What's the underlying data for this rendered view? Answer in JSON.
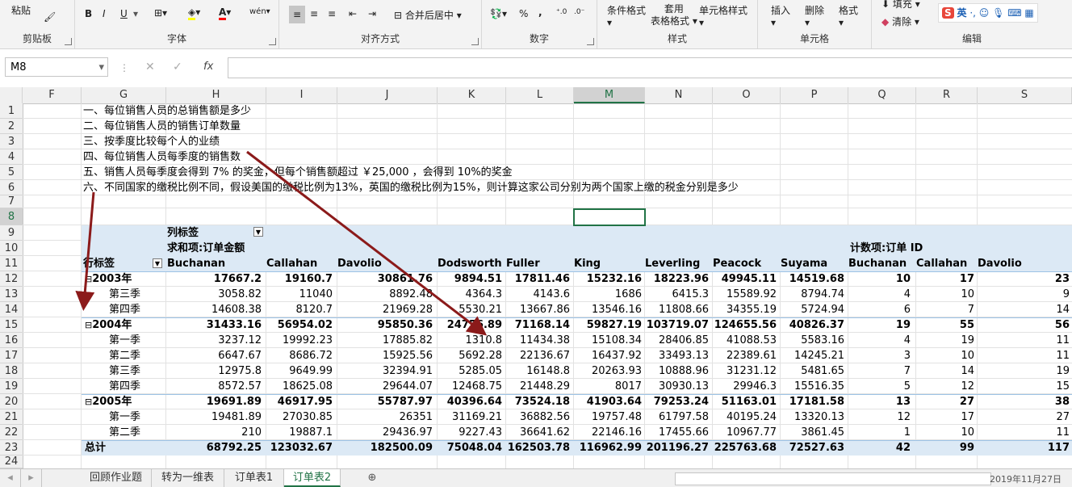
{
  "ribbon": {
    "clipboard": {
      "paste": "粘贴",
      "title": "剪贴板"
    },
    "font": {
      "bold": "B",
      "italic": "I",
      "underline": "U",
      "font_color": "A",
      "title": "字体"
    },
    "align": {
      "merge": "合并后居中",
      "title": "对齐方式"
    },
    "number": {
      "percent": "%",
      "comma": ",",
      "title": "数字"
    },
    "styles": {
      "conditional": "条件格式",
      "table_line1": "套用",
      "table_line2": "表格格式",
      "cell_styles": "单元格样式",
      "title": "样式"
    },
    "cells": {
      "insert": "插入",
      "delete": "删除",
      "format": "格式",
      "title": "单元格"
    },
    "edit": {
      "fill": "填充",
      "clear": "清除",
      "title": "编辑"
    },
    "ime": {
      "lang": "英"
    }
  },
  "formula": {
    "name_box": "M8",
    "fx": "fx"
  },
  "columns": [
    "F",
    "G",
    "H",
    "I",
    "J",
    "K",
    "L",
    "M",
    "N",
    "O",
    "P",
    "Q",
    "R",
    "S"
  ],
  "rows": [
    "1",
    "2",
    "3",
    "4",
    "5",
    "6",
    "7",
    "8",
    "9",
    "10",
    "11",
    "12",
    "13",
    "14",
    "15",
    "16",
    "17",
    "18",
    "19",
    "20",
    "21",
    "22",
    "23",
    "24"
  ],
  "questions": [
    "一、每位销售人员的总销售额是多少",
    "二、每位销售人员的销售订单数量",
    "三、按季度比较每个人的业绩",
    "四、每位销售人员每季度的销售数",
    "五、销售人员每季度会得到 7% 的奖金，但每个销售额超过 ￥25,000 ，会得到 10%的奖金",
    "六、不同国家的缴税比例不同，假设美国的缴税比例为13%，英国的缴税比例为15%，则计算这家公司分别为两个国家上缴的税金分别是多少"
  ],
  "pivot": {
    "col_label": "列标签",
    "sum_label": "求和项:订单金额",
    "count_label": "计数项:订单 ID",
    "row_label": "行标签",
    "headers": [
      "Buchanan",
      "Callahan",
      "Davolio",
      "Dodsworth",
      "Fuller",
      "King",
      "Leverling",
      "Peacock",
      "Suyama",
      "Buchanan",
      "Callahan",
      "Davolio"
    ],
    "rows": [
      {
        "label": "2003年",
        "level": 0,
        "collapse": "⊟",
        "values": [
          "17667.2",
          "19160.7",
          "30861.76",
          "9894.51",
          "17811.46",
          "15232.16",
          "18223.96",
          "49945.11",
          "14519.68",
          "10",
          "17",
          "23"
        ]
      },
      {
        "label": "第三季",
        "level": 1,
        "values": [
          "3058.82",
          "11040",
          "8892.48",
          "4364.3",
          "4143.6",
          "1686",
          "6415.3",
          "15589.92",
          "8794.74",
          "4",
          "10",
          "9"
        ]
      },
      {
        "label": "第四季",
        "level": 1,
        "values": [
          "14608.38",
          "8120.7",
          "21969.28",
          "5530.21",
          "13667.86",
          "13546.16",
          "11808.66",
          "34355.19",
          "5724.94",
          "6",
          "7",
          "14"
        ]
      },
      {
        "label": "2004年",
        "level": 0,
        "collapse": "⊟",
        "values": [
          "31433.16",
          "56954.02",
          "95850.36",
          "24756.89",
          "71168.14",
          "59827.19",
          "103719.07",
          "124655.56",
          "40826.37",
          "19",
          "55",
          "56"
        ]
      },
      {
        "label": "第一季",
        "level": 1,
        "values": [
          "3237.12",
          "19992.23",
          "17885.82",
          "1310.8",
          "11434.38",
          "15108.34",
          "28406.85",
          "41088.53",
          "5583.16",
          "4",
          "19",
          "11"
        ]
      },
      {
        "label": "第二季",
        "level": 1,
        "values": [
          "6647.67",
          "8686.72",
          "15925.56",
          "5692.28",
          "22136.67",
          "16437.92",
          "33493.13",
          "22389.61",
          "14245.21",
          "3",
          "10",
          "11"
        ]
      },
      {
        "label": "第三季",
        "level": 1,
        "values": [
          "12975.8",
          "9649.99",
          "32394.91",
          "5285.05",
          "16148.8",
          "20263.93",
          "10888.96",
          "31231.12",
          "5481.65",
          "7",
          "14",
          "19"
        ]
      },
      {
        "label": "第四季",
        "level": 1,
        "values": [
          "8572.57",
          "18625.08",
          "29644.07",
          "12468.75",
          "21448.29",
          "8017",
          "30930.13",
          "29946.3",
          "15516.35",
          "5",
          "12",
          "15"
        ]
      },
      {
        "label": "2005年",
        "level": 0,
        "collapse": "⊟",
        "values": [
          "19691.89",
          "46917.95",
          "55787.97",
          "40396.64",
          "73524.18",
          "41903.64",
          "79253.24",
          "51163.01",
          "17181.58",
          "13",
          "27",
          "38"
        ]
      },
      {
        "label": "第一季",
        "level": 1,
        "values": [
          "19481.89",
          "27030.85",
          "26351",
          "31169.21",
          "36882.56",
          "19757.48",
          "61797.58",
          "40195.24",
          "13320.13",
          "12",
          "17",
          "27"
        ]
      },
      {
        "label": "第二季",
        "level": 1,
        "values": [
          "210",
          "19887.1",
          "29436.97",
          "9227.43",
          "36641.62",
          "22146.16",
          "17455.66",
          "10967.77",
          "3861.45",
          "1",
          "10",
          "11"
        ]
      },
      {
        "label": "总计",
        "level": 0,
        "total": true,
        "values": [
          "68792.25",
          "123032.67",
          "182500.09",
          "75048.04",
          "162503.78",
          "116962.99",
          "201196.27",
          "225763.68",
          "72527.63",
          "42",
          "99",
          "117"
        ]
      }
    ]
  },
  "tabs": [
    "回顾作业题",
    "转为一维表",
    "订单表1",
    "订单表2"
  ],
  "active_tab": 3,
  "status_date": "2019年11月27日",
  "colors": {
    "accent": "#217346",
    "pivot_band": "#dce9f5",
    "arrow": "#8b1a1a"
  }
}
